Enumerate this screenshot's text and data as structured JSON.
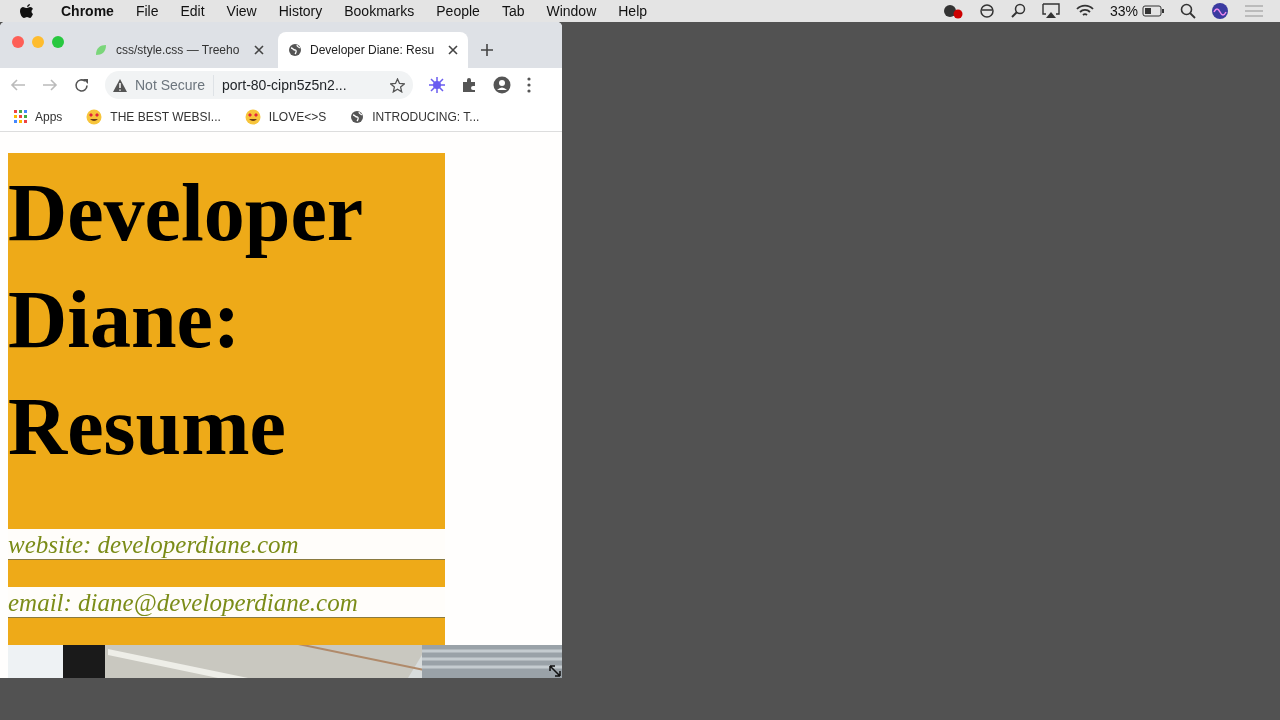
{
  "menu_bar": {
    "app": "Chrome",
    "items": [
      "File",
      "Edit",
      "View",
      "History",
      "Bookmarks",
      "People",
      "Tab",
      "Window",
      "Help"
    ],
    "battery": "33%"
  },
  "tabs": [
    {
      "title": "css/style.css — Treeho",
      "kind": "leaf",
      "selected": false
    },
    {
      "title": "Developer Diane: Resu",
      "kind": "globe",
      "selected": true
    }
  ],
  "address_bar": {
    "security": "Not Secure",
    "url": "port-80-cipn5z5n2..."
  },
  "bookmarks": [
    {
      "label": "Apps",
      "kind": "apps"
    },
    {
      "label": "THE BEST WEBSI...",
      "kind": "emoji"
    },
    {
      "label": "ILOVE<>S",
      "kind": "emoji"
    },
    {
      "label": "INTRODUCING: T...",
      "kind": "globe"
    }
  ],
  "page": {
    "heading": "Developer Diane: Resume",
    "contacts": [
      "website: developerdiane.com",
      "email: diane@developerdiane.com"
    ]
  }
}
